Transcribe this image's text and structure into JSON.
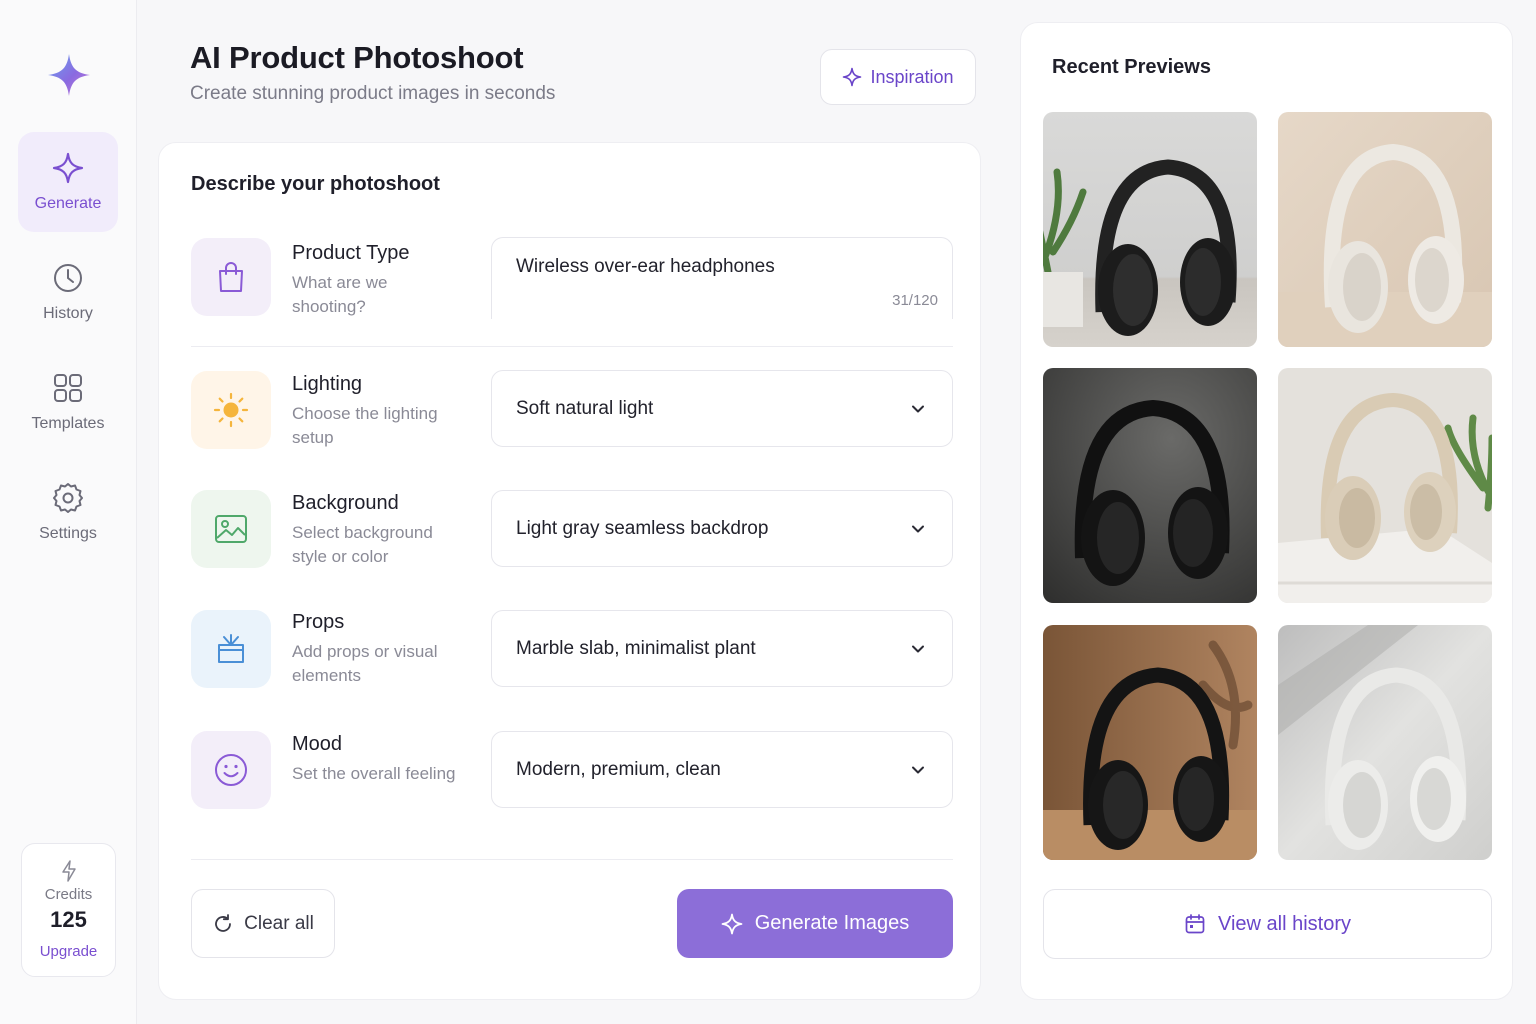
{
  "header": {
    "title": "AI Product Photoshoot",
    "subtitle": "Create stunning product images in seconds",
    "inspiration_label": "Inspiration"
  },
  "sidebar": {
    "items": [
      {
        "label": "Generate",
        "icon": "sparkle-icon",
        "active": true
      },
      {
        "label": "History",
        "icon": "clock-icon",
        "active": false
      },
      {
        "label": "Templates",
        "icon": "grid-icon",
        "active": false
      },
      {
        "label": "Settings",
        "icon": "gear-icon",
        "active": false
      }
    ],
    "credits": {
      "label": "Credits",
      "value": "125",
      "upgrade_label": "Upgrade"
    }
  },
  "form": {
    "heading": "Describe your photoshoot",
    "product_type": {
      "title": "Product Type",
      "description": "What are we shooting?",
      "value": "Wireless over-ear headphones",
      "counter": "31/120",
      "icon": "shopping-bag-icon"
    },
    "lighting": {
      "title": "Lighting",
      "description": "Choose the lighting setup",
      "value": "Soft natural light",
      "icon": "sun-icon"
    },
    "background": {
      "title": "Background",
      "description": "Select background style or color",
      "value": "Light gray seamless backdrop",
      "icon": "image-icon"
    },
    "props": {
      "title": "Props",
      "description": "Add props or visual elements",
      "value": "Marble slab, minimalist plant",
      "icon": "gift-box-icon"
    },
    "mood": {
      "title": "Mood",
      "description": "Set the overall feeling",
      "value": "Modern, premium, clean",
      "icon": "smile-icon"
    },
    "clear_label": "Clear all",
    "generate_label": "Generate Images"
  },
  "previews": {
    "title": "Recent Previews",
    "view_history_label": "View all history"
  },
  "colors": {
    "accent": "#7a4fd0",
    "accent_button": "#8c6ed8",
    "sidebar_active_bg": "#f1ecfb",
    "lighting_icon_bg": "#fff5e8",
    "background_icon_bg": "#eef6ee",
    "props_icon_bg": "#eaf3fb",
    "mood_icon_bg": "#f3eef9"
  }
}
